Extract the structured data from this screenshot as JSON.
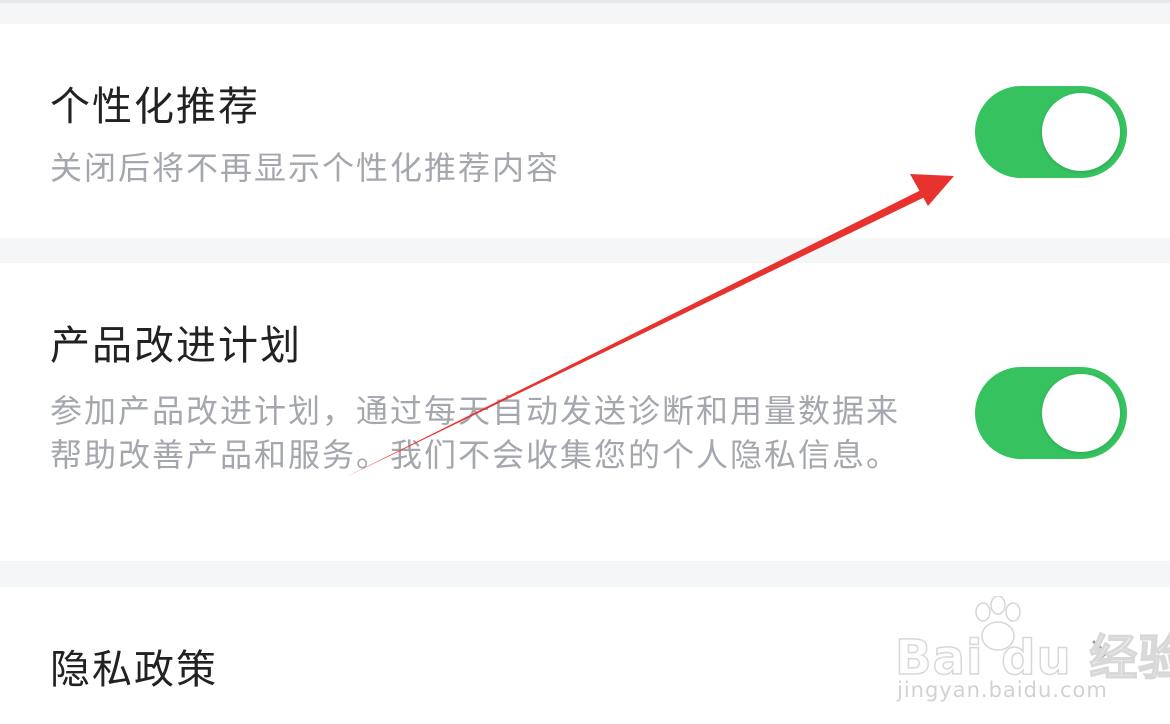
{
  "settings": {
    "personalized": {
      "title": "个性化推荐",
      "description": "关闭后将不再显示个性化推荐内容",
      "enabled": true
    },
    "improvement": {
      "title": "产品改进计划",
      "description": "参加产品改进计划，通过每天自动发送诊断和用量数据来帮助改善产品和服务。我们不会收集您的个人隐私信息。",
      "enabled": true
    },
    "privacy_policy": {
      "title": "隐私政策"
    }
  },
  "watermark": {
    "brand": "Bai du 经验",
    "url": "jingyan.baidu.com"
  },
  "colors": {
    "toggle_on": "#35c25f",
    "background": "#f5f6f8",
    "annotation_arrow": "#e8322e"
  },
  "icons": {
    "chevron": "chevron-right-icon",
    "watermark": "baidu-paw-icon"
  }
}
